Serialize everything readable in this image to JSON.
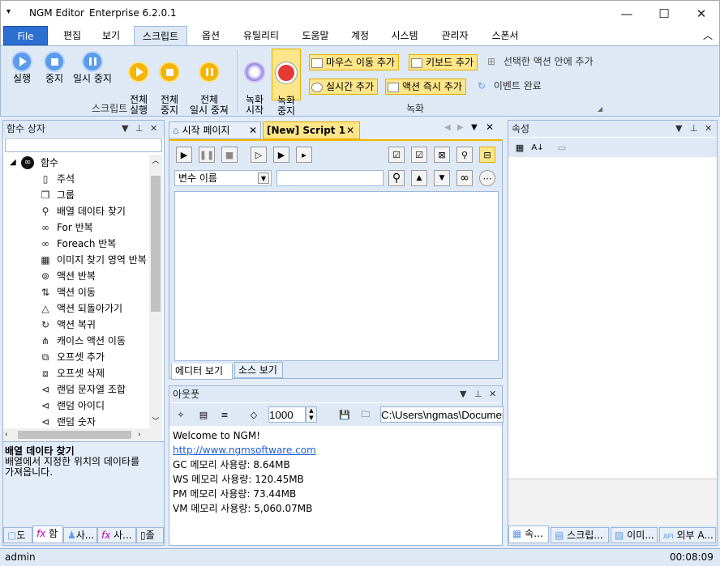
{
  "window": {
    "title": "NGM Editor",
    "edition": "Enterprise 6.2.0.1",
    "menu_glyph": "▾",
    "minimize": "—",
    "maximize": "☐",
    "close": "✕"
  },
  "menu": {
    "items": [
      "File",
      "편집",
      "보기",
      "스크립트",
      "옵션",
      "유틸리티",
      "도움말",
      "계정",
      "시스템",
      "관리자",
      "스폰서"
    ],
    "collapse_glyph": "︿"
  },
  "ribbon": {
    "script_group": {
      "label": "스크립트",
      "buttons": [
        {
          "label": "실행",
          "icon": "play-icon"
        },
        {
          "label": "중지",
          "icon": "stop-icon"
        },
        {
          "label": "일시 중지",
          "icon": "pause-icon"
        },
        {
          "label": "전체\n실행",
          "icon": "play-all-icon"
        },
        {
          "label": "전체\n중지",
          "icon": "stop-all-icon"
        },
        {
          "label": "전체\n일시 중지",
          "icon": "pause-all-icon"
        }
      ]
    },
    "record_group": {
      "label": "녹화",
      "record_start": "녹화\n시작",
      "record_stop": "녹화\n중지",
      "chips": [
        "마우스 이동 추가",
        "키보드 추가",
        "실시간 추가",
        "액션 즉시 추가"
      ],
      "plain": [
        "선택한 액션 안에 추가",
        "이벤트 완료"
      ]
    },
    "colors": {
      "accent": "#2b6fd1",
      "highlight": "#fde68a"
    }
  },
  "left_panel": {
    "title": "함수 상자",
    "root": "함수",
    "items": [
      {
        "label": "주석",
        "icon": "comment-icon",
        "glyph": "▯"
      },
      {
        "label": "그룹",
        "icon": "group-icon",
        "glyph": "❐"
      },
      {
        "label": "배열 데이타 찾기",
        "icon": "search-icon",
        "glyph": "⚲"
      },
      {
        "label": "For 반복",
        "icon": "infinity-icon",
        "glyph": "∞"
      },
      {
        "label": "Foreach 반복",
        "icon": "infinity-icon",
        "glyph": "∞"
      },
      {
        "label": "이미지 찾기 영역 반복",
        "icon": "image-loop-icon",
        "glyph": "▦"
      },
      {
        "label": "액션 반복",
        "icon": "action-loop-icon",
        "glyph": "⊚"
      },
      {
        "label": "액션 이동",
        "icon": "action-move-icon",
        "glyph": "⇅"
      },
      {
        "label": "액션 되돌아가기",
        "icon": "action-back-icon",
        "glyph": "△"
      },
      {
        "label": "액션 복귀",
        "icon": "refresh-icon",
        "glyph": "↻"
      },
      {
        "label": "캐이스 액션 이동",
        "icon": "case-move-icon",
        "glyph": "⋔"
      },
      {
        "label": "오프셋 추가",
        "icon": "offset-add-icon",
        "glyph": "⧉"
      },
      {
        "label": "오프셋 삭제",
        "icon": "offset-remove-icon",
        "glyph": "⧈"
      },
      {
        "label": "랜덤 문자열 조합",
        "icon": "random-string-icon",
        "glyph": "⊲"
      },
      {
        "label": "랜덤 아이디",
        "icon": "random-id-icon",
        "glyph": "⊲"
      },
      {
        "label": "랜덤 숫자",
        "icon": "random-number-icon",
        "glyph": "⊲"
      }
    ],
    "desc_title": "배열 데이타 찾기",
    "desc_text": "배열에서 지정한 위치의 데이타를\n가져옵니다.",
    "bottom_tabs": [
      "도",
      "함",
      "사...",
      "사...",
      "졸"
    ]
  },
  "editor": {
    "tabs": [
      {
        "label": "시작 페이지",
        "active": false
      },
      {
        "label": "[New] Script 1",
        "active": true
      }
    ],
    "variable_select": "변수 이름",
    "variable_value": "",
    "view_tabs": [
      "에디터 보기",
      "소스 보기"
    ]
  },
  "output": {
    "title": "아웃풋",
    "delay_value": "1000",
    "path_value": "C:\\Users\\ngmas\\Documents",
    "lines": [
      {
        "text": "Welcome to NGM!",
        "link": false
      },
      {
        "text": "http://www.ngmsoftware.com",
        "link": true
      },
      {
        "text": "GC 메모리 사용량: 8.64MB",
        "link": false
      },
      {
        "text": "WS 메모리 사용량: 120.45MB",
        "link": false
      },
      {
        "text": "PM 메모리 사용량: 73.44MB",
        "link": false
      },
      {
        "text": "VM 메모리 사용량: 5,060.07MB",
        "link": false
      }
    ]
  },
  "right_panel": {
    "title": "속성",
    "bottom_tabs": [
      "속...",
      "스크립...",
      "이미...",
      "외부 A..."
    ]
  },
  "statusbar": {
    "user": "admin",
    "time": "00:08:09"
  }
}
